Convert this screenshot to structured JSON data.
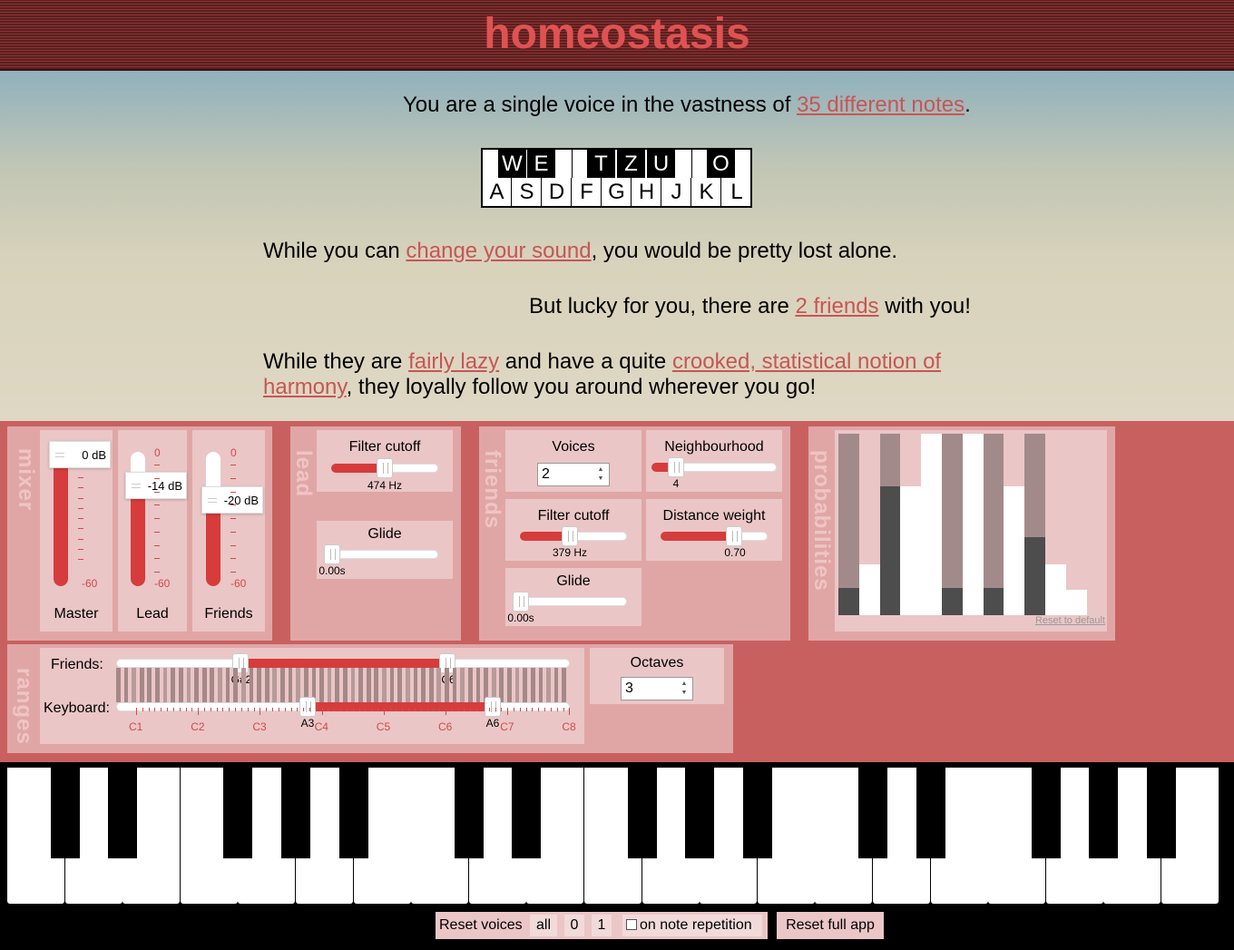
{
  "app": {
    "title": "homeostasis"
  },
  "intro": {
    "line1_pre": "You are a single voice in the vastness of ",
    "line1_link": "35 different notes",
    "line1_post": ".",
    "line2_pre": "While you can ",
    "line2_link": "change your sound",
    "line2_post": ", you would be pretty lost alone.",
    "line3_pre": "But lucky for you, there are ",
    "line3_link": "2 friends",
    "line3_post": " with you!",
    "line4_pre": "While they are ",
    "line4_link1": "fairly lazy",
    "line4_mid": " and have a quite ",
    "line4_link2a": "crooked, statistical notion of",
    "line4_link2b": "harmony",
    "line4_post": ", they loyally follow you around wherever you go!"
  },
  "keyhint": {
    "black": [
      "W",
      "E",
      "T",
      "Z",
      "U",
      "O"
    ],
    "white": [
      "A",
      "S",
      "D",
      "F",
      "G",
      "H",
      "J",
      "K",
      "L"
    ]
  },
  "mixer": {
    "label": "mixer",
    "channels": [
      {
        "name": "Master",
        "db": "0 dB",
        "top": "0",
        "bottom": "-60",
        "level": 1.0
      },
      {
        "name": "Lead",
        "db": "-14 dB",
        "top": "0",
        "bottom": "-60",
        "level": 0.77
      },
      {
        "name": "Friends",
        "db": "-20 dB",
        "top": "0",
        "bottom": "-60",
        "level": 0.67
      }
    ]
  },
  "lead": {
    "label": "lead",
    "cutoff_label": "Filter cutoff",
    "cutoff_value": "474 Hz",
    "cutoff_level": 0.5,
    "glide_label": "Glide",
    "glide_value": "0.00s",
    "glide_level": 0.0
  },
  "friends": {
    "label": "friends",
    "voices_label": "Voices",
    "voices_value": "2",
    "neighbourhood_label": "Neighbourhood",
    "neighbourhood_value": "4",
    "neighbourhood_level": 0.18,
    "cutoff_label": "Filter cutoff",
    "cutoff_value": "379 Hz",
    "cutoff_level": 0.45,
    "distance_label": "Distance weight",
    "distance_value": "0.70",
    "distance_level": 0.7,
    "glide_label": "Glide",
    "glide_value": "0.00s",
    "glide_level": 0.0
  },
  "probabilities": {
    "label": "probabilities",
    "reset_label": "Reset to default",
    "columns": [
      {
        "top": "#a38a8a",
        "dark": 0.15
      },
      {
        "top": "#ffffff",
        "dark": 0.0,
        "gray": 0.72
      },
      {
        "top": "#a38a8a",
        "dark": 0.71
      },
      {
        "top": "#ffffff",
        "dark": 0.0,
        "gray": 0.29
      },
      {
        "top": "#ffffff",
        "dark": 0.0,
        "gray": 0.0
      },
      {
        "top": "#a38a8a",
        "dark": 0.15
      },
      {
        "top": "#ffffff",
        "dark": 0.0,
        "gray": 0.0
      },
      {
        "top": "#a38a8a",
        "dark": 0.15
      },
      {
        "top": "#ffffff",
        "dark": 0.0,
        "gray": 0.29
      },
      {
        "top": "#a38a8a",
        "dark": 0.43
      },
      {
        "top": "#ffffff",
        "dark": 0.0,
        "gray": 0.72
      },
      {
        "top": "#ffffff",
        "dark": 0.0,
        "gray": 0.86
      }
    ]
  },
  "ranges": {
    "label": "ranges",
    "friends_label": "Friends:",
    "keyboard_label": "Keyboard:",
    "friends_low": "G#2",
    "friends_high": "C6",
    "keyboard_low": "A3",
    "keyboard_high": "A6",
    "octave_ticks": [
      "C1",
      "C2",
      "C3",
      "C4",
      "C5",
      "C6",
      "C7",
      "C8"
    ],
    "octaves_label": "Octaves",
    "octaves_value": "3"
  },
  "footer": {
    "reset_voices": "Reset voices",
    "all": "all",
    "zero": "0",
    "one": "1",
    "on_repetition": "on note repetition",
    "reset_app": "Reset full app"
  },
  "colors": {
    "accent": "#d63c3c",
    "panel": "#c96060",
    "link": "#c85555",
    "title": "#e05252"
  }
}
